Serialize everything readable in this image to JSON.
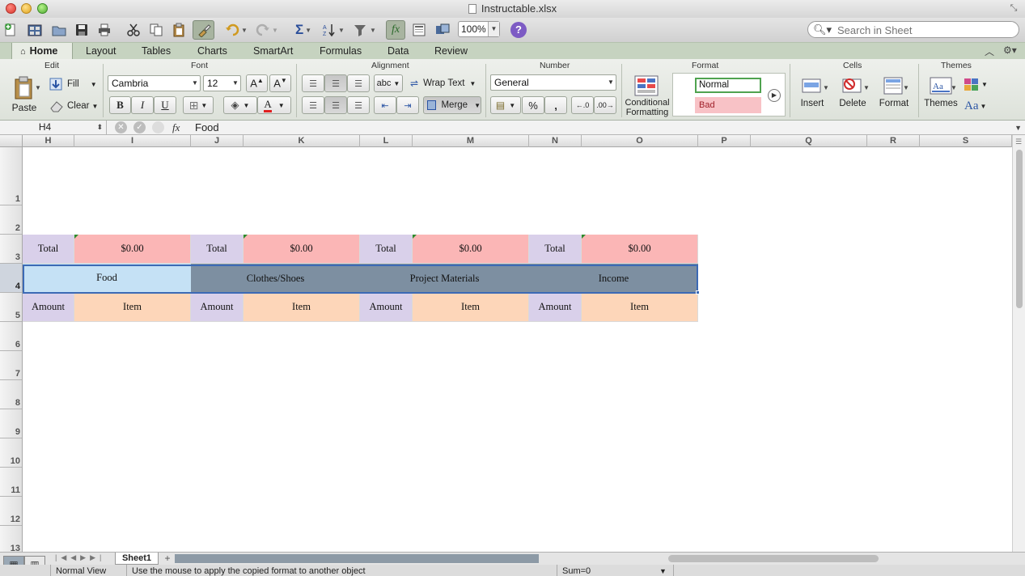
{
  "window": {
    "title": "Instructable.xlsx"
  },
  "toolbar": {
    "zoom": "100%"
  },
  "search": {
    "placeholder": "Search in Sheet"
  },
  "ribbon_tabs": [
    {
      "label": "Home"
    },
    {
      "label": "Layout"
    },
    {
      "label": "Tables"
    },
    {
      "label": "Charts"
    },
    {
      "label": "SmartArt"
    },
    {
      "label": "Formulas"
    },
    {
      "label": "Data"
    },
    {
      "label": "Review"
    }
  ],
  "groups": {
    "edit": "Edit",
    "font": "Font",
    "alignment": "Alignment",
    "number": "Number",
    "format": "Format",
    "cells": "Cells",
    "themes": "Themes"
  },
  "edit": {
    "paste": "Paste",
    "fill": "Fill",
    "clear": "Clear"
  },
  "font": {
    "family": "Cambria",
    "size": "12"
  },
  "alignment": {
    "wrap_text": "Wrap Text",
    "merge": "Merge",
    "orientation": "abc"
  },
  "number": {
    "format": "General"
  },
  "format": {
    "conditional_line1": "Conditional",
    "conditional_line2": "Formatting",
    "style_normal": "Normal",
    "style_bad": "Bad"
  },
  "cells": {
    "insert": "Insert",
    "delete": "Delete",
    "format": "Format"
  },
  "themes": {
    "themes": "Themes",
    "fonts": "Aa"
  },
  "formula_bar": {
    "cell_ref": "H4",
    "fx": "fx",
    "content": "Food"
  },
  "columns": [
    "H",
    "I",
    "J",
    "K",
    "L",
    "M",
    "N",
    "O",
    "P",
    "Q",
    "R",
    "S"
  ],
  "rows": [
    "1",
    "2",
    "3",
    "4",
    "5",
    "6",
    "7",
    "8",
    "9",
    "10",
    "11",
    "12",
    "13"
  ],
  "sheet": {
    "row3": [
      "Total",
      "$0.00",
      "Total",
      "$0.00",
      "Total",
      "$0.00",
      "Total",
      "$0.00"
    ],
    "row4": [
      "Food",
      "Clothes/Shoes",
      "Project Materials",
      "Income"
    ],
    "row5": [
      "Amount",
      "Item",
      "Amount",
      "Item",
      "Amount",
      "Item",
      "Amount",
      "Item"
    ]
  },
  "sheet_tabs": [
    {
      "label": "Sheet1"
    }
  ],
  "status": {
    "view": "Normal View",
    "message": "Use the mouse to apply the copied format to another object",
    "sum": "Sum=0"
  },
  "colors": {
    "lavender": "#d9d0ea",
    "pink": "#fbb6b6",
    "peach": "#fdd6b9",
    "selected_blue": "#c5e1f5",
    "slate": "#7d8fa1"
  }
}
